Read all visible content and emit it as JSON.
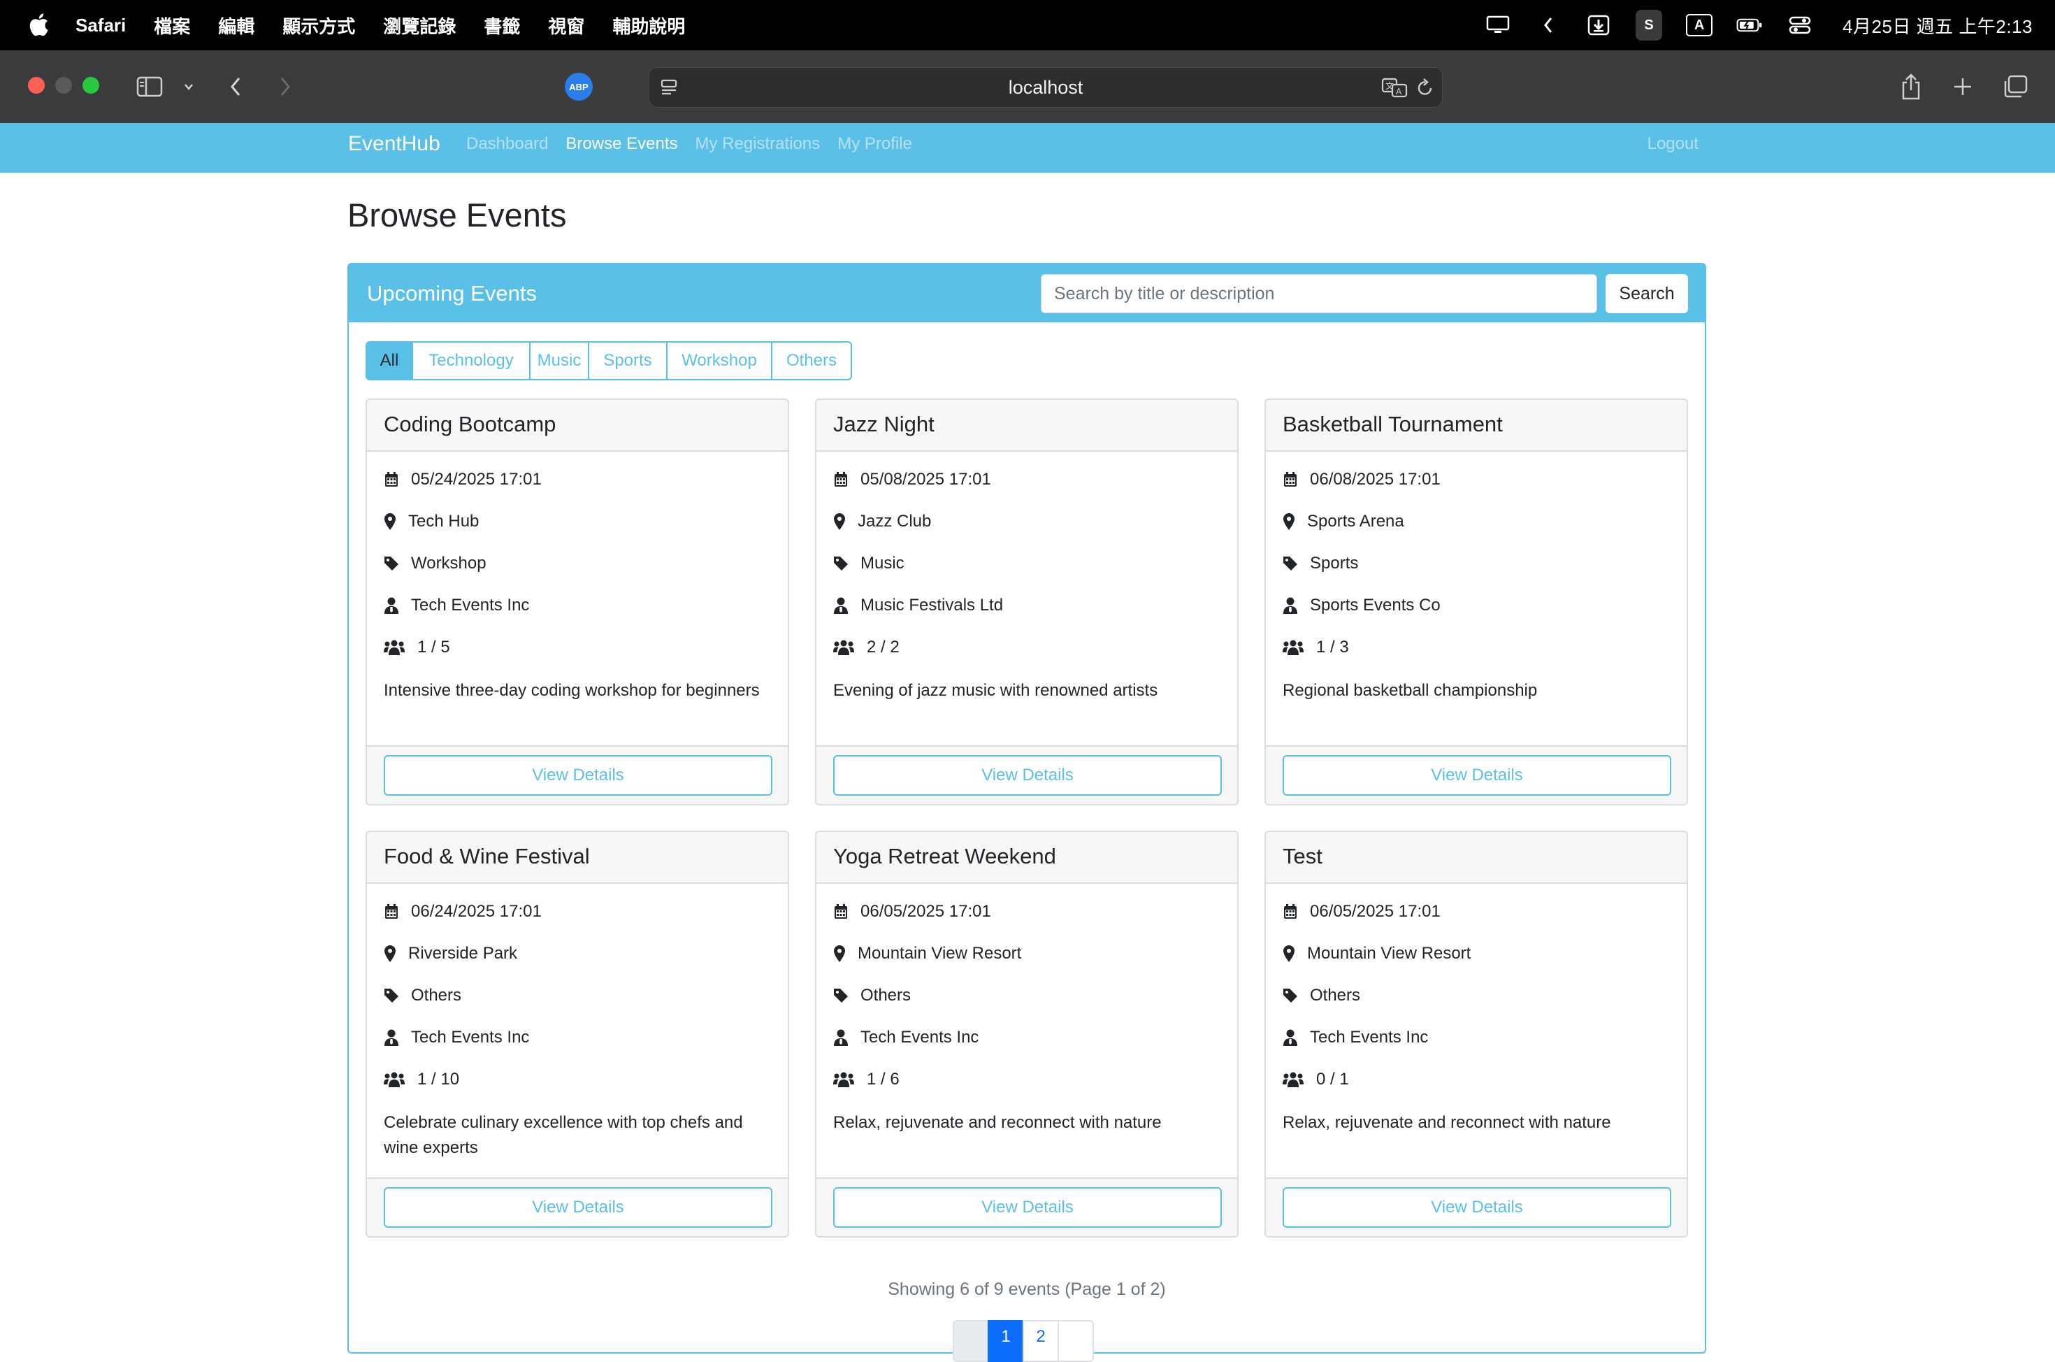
{
  "menubar": {
    "app_name": "Safari",
    "menus": [
      "檔案",
      "編輯",
      "顯示方式",
      "瀏覽記錄",
      "書籤",
      "視窗",
      "輔助說明"
    ],
    "status_box_s": "S",
    "status_box_a": "A",
    "clock": "4月25日 週五 上午2:13"
  },
  "browser": {
    "url": "localhost",
    "abp_label": "ABP"
  },
  "navbar": {
    "brand": "EventHub",
    "links": [
      "Dashboard",
      "Browse Events",
      "My Registrations",
      "My Profile"
    ],
    "active_link": "Browse Events",
    "logout": "Logout"
  },
  "page": {
    "title": "Browse Events"
  },
  "panel": {
    "title": "Upcoming Events",
    "search_placeholder": "Search by title or description",
    "search_button": "Search",
    "filters": [
      "All",
      "Technology",
      "Music",
      "Sports",
      "Workshop",
      "Others"
    ],
    "active_filter": "All"
  },
  "events": [
    {
      "title": "Coding Bootcamp",
      "date": "05/24/2025 17:01",
      "location": "Tech Hub",
      "category": "Workshop",
      "organizer": "Tech Events Inc",
      "capacity": "1 / 5",
      "description": "Intensive three-day coding workshop for beginners",
      "button": "View Details"
    },
    {
      "title": "Jazz Night",
      "date": "05/08/2025 17:01",
      "location": "Jazz Club",
      "category": "Music",
      "organizer": "Music Festivals Ltd",
      "capacity": "2 / 2",
      "description": "Evening of jazz music with renowned artists",
      "button": "View Details"
    },
    {
      "title": "Basketball Tournament",
      "date": "06/08/2025 17:01",
      "location": "Sports Arena",
      "category": "Sports",
      "organizer": "Sports Events Co",
      "capacity": "1 / 3",
      "description": "Regional basketball championship",
      "button": "View Details"
    },
    {
      "title": "Food & Wine Festival",
      "date": "06/24/2025 17:01",
      "location": "Riverside Park",
      "category": "Others",
      "organizer": "Tech Events Inc",
      "capacity": "1 / 10",
      "description": "Celebrate culinary excellence with top chefs and wine experts",
      "button": "View Details"
    },
    {
      "title": "Yoga Retreat Weekend",
      "date": "06/05/2025 17:01",
      "location": "Mountain View Resort",
      "category": "Others",
      "organizer": "Tech Events Inc",
      "capacity": "1 / 6",
      "description": "Relax, rejuvenate and reconnect with nature",
      "button": "View Details"
    },
    {
      "title": "Test",
      "date": "06/05/2025 17:01",
      "location": "Mountain View Resort",
      "category": "Others",
      "organizer": "Tech Events Inc",
      "capacity": "0 / 1",
      "description": "Relax, rejuvenate and reconnect with nature",
      "button": "View Details"
    }
  ],
  "pagination": {
    "summary": "Showing 6 of 9 events (Page 1 of 2)",
    "pages": [
      "1",
      "2"
    ],
    "current": "1"
  },
  "colors": {
    "accent": "#5bc0e8",
    "primary": "#0d6efd",
    "menubar": "#000000",
    "toolbar": "#3b3b3d"
  },
  "icons": [
    "calendar-icon",
    "map-marker-icon",
    "tag-icon",
    "user-tie-icon",
    "users-icon"
  ]
}
